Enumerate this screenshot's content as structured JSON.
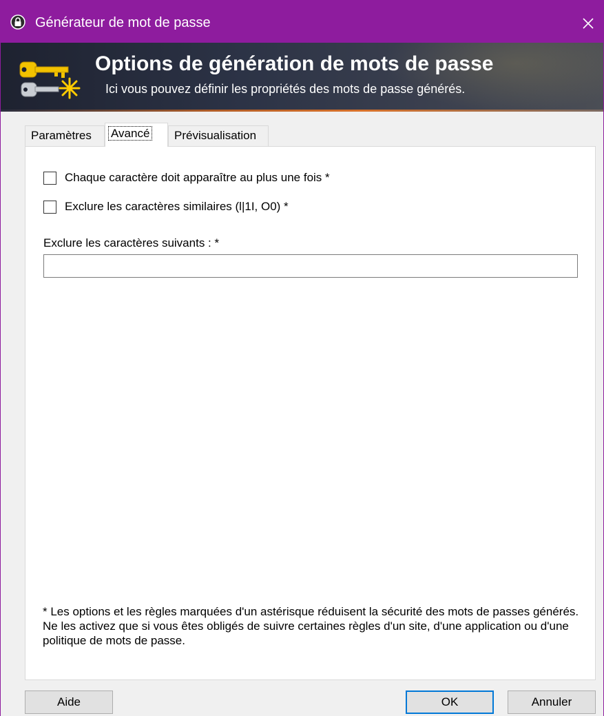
{
  "window": {
    "title": "Générateur de mot de passe",
    "accent_color": "#8e1c9e",
    "icons": {
      "app": "lock-icon",
      "close": "close-icon",
      "banner": "keys-icon"
    }
  },
  "banner": {
    "heading": "Options de génération de mots de passe",
    "subheading": "Ici vous pouvez définir les propriétés des mots de passe générés."
  },
  "tabs": [
    {
      "label": "Paramètres",
      "selected": false
    },
    {
      "label": "Avancé",
      "selected": true
    },
    {
      "label": "Prévisualisation",
      "selected": false
    }
  ],
  "advanced": {
    "unique_chars": {
      "label": "Chaque caractère doit apparaître au plus une fois *",
      "checked": false
    },
    "exclude_similar": {
      "label": "Exclure les caractères similaires (l|1I, O0) *",
      "checked": false
    },
    "exclude_chars": {
      "label": "Exclure les caractères suivants : *",
      "value": ""
    },
    "note": "* Les options et les règles marquées d'un astérisque réduisent la sécurité des mots de passes générés. Ne les activez que si vous êtes obligés de suivre certaines règles d'un site, d'une application ou d'une politique de mots de passe."
  },
  "buttons": {
    "help": "Aide",
    "ok": "OK",
    "cancel": "Annuler"
  }
}
